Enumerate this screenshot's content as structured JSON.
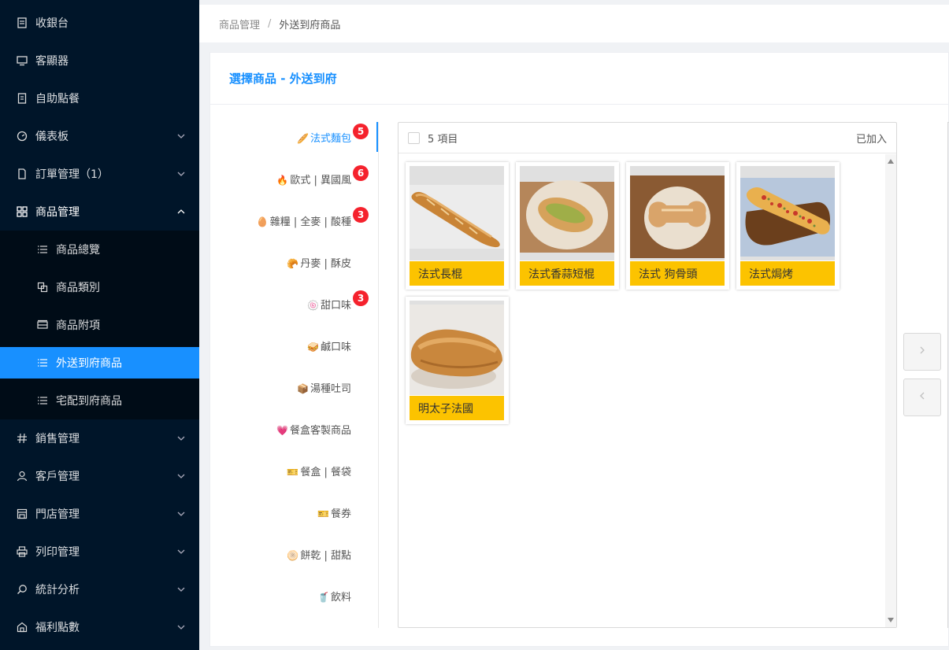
{
  "sidebar": {
    "items": [
      {
        "label": "收銀台",
        "icon": "cashier-icon"
      },
      {
        "label": "客顯器",
        "icon": "monitor-icon"
      },
      {
        "label": "自助點餐",
        "icon": "receipt-icon"
      },
      {
        "label": "儀表板",
        "icon": "dashboard-icon"
      },
      {
        "label": "訂單管理（1）",
        "icon": "file-icon"
      },
      {
        "label": "商品管理",
        "icon": "grid-icon"
      }
    ],
    "sub_items": [
      {
        "label": "商品總覽",
        "icon": "list-icon"
      },
      {
        "label": "商品類別",
        "icon": "copy-icon"
      },
      {
        "label": "商品附項",
        "icon": "table-icon"
      },
      {
        "label": "外送到府商品",
        "icon": "list-icon"
      },
      {
        "label": "宅配到府商品",
        "icon": "list-icon"
      }
    ],
    "bottom_items": [
      {
        "label": "銷售管理",
        "icon": "hash-icon"
      },
      {
        "label": "客戶管理",
        "icon": "user-icon"
      },
      {
        "label": "門店管理",
        "icon": "store-icon"
      },
      {
        "label": "列印管理",
        "icon": "printer-icon"
      },
      {
        "label": "統計分析",
        "icon": "search-icon"
      },
      {
        "label": "福利點數",
        "icon": "gift-icon"
      }
    ]
  },
  "breadcrumb": {
    "parent": "商品管理",
    "separator": "/",
    "current": "外送到府商品"
  },
  "card": {
    "title": "選擇商品 - 外送到府"
  },
  "categories": [
    {
      "emoji": "🥖",
      "label": "法式麵包",
      "badge": "5"
    },
    {
      "emoji": "🔥",
      "label": "歐式 | 異國風",
      "badge": "6"
    },
    {
      "emoji": "🥚",
      "label": "雜糧 | 全麥 | 酸種",
      "badge": "3"
    },
    {
      "emoji": "🥐",
      "label": "丹麥 | 酥皮",
      "badge": ""
    },
    {
      "emoji": "🍥",
      "label": "甜口味",
      "badge": "3"
    },
    {
      "emoji": "🥪",
      "label": "鹹口味",
      "badge": ""
    },
    {
      "emoji": "📦",
      "label": "湯種吐司",
      "badge": ""
    },
    {
      "emoji": "💗",
      "label": "餐盒客製商品",
      "badge": ""
    },
    {
      "emoji": "🎫",
      "label": "餐盒 | 餐袋",
      "badge": ""
    },
    {
      "emoji": "🎫",
      "label": "餐券",
      "badge": ""
    },
    {
      "emoji": "🫓",
      "label": "餅乾 | 甜點",
      "badge": ""
    },
    {
      "emoji": "🥤",
      "label": "飲料",
      "badge": ""
    }
  ],
  "transfer": {
    "count_label": "5 項目",
    "added_label": "已加入",
    "products": [
      {
        "name": "法式長棍"
      },
      {
        "name": "法式香蒜短棍"
      },
      {
        "name": "法式 狗骨頭"
      },
      {
        "name": "法式焗烤"
      },
      {
        "name": "明太子法國"
      }
    ],
    "move_right": ">",
    "move_left": "<"
  },
  "colors": {
    "accent": "#1890ff",
    "sidebar": "#001529",
    "badge": "#f5222d",
    "label_bg": "#fcc300"
  }
}
